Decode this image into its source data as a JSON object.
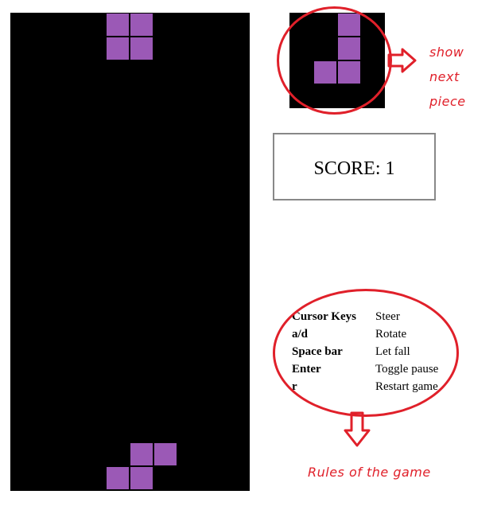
{
  "game": {
    "board": {
      "background_color": "#000000",
      "rows": 20,
      "cols": 10,
      "piece_color": "#9b59b6",
      "falling_piece": {
        "shape": "O",
        "cells": [
          [
            0,
            4
          ],
          [
            0,
            5
          ],
          [
            1,
            4
          ],
          [
            1,
            5
          ]
        ]
      },
      "stacked_blocks": {
        "shape": "S",
        "cells": [
          [
            18,
            5
          ],
          [
            18,
            6
          ],
          [
            19,
            4
          ],
          [
            19,
            5
          ]
        ]
      }
    },
    "next_piece": {
      "shape": "J",
      "color": "#9b59b6",
      "rows": 4,
      "cols": 4,
      "cells": [
        [
          0,
          2
        ],
        [
          1,
          2
        ],
        [
          2,
          1
        ],
        [
          2,
          2
        ]
      ]
    },
    "score": {
      "text": "SCORE: 1",
      "label": "SCORE:",
      "value": 1
    },
    "controls": [
      {
        "key": "Cursor Keys",
        "action": "Steer"
      },
      {
        "key": "a/d",
        "action": "Rotate"
      },
      {
        "key": "Space bar",
        "action": "Let fall"
      },
      {
        "key": "Enter",
        "action": "Toggle pause"
      },
      {
        "key": "r",
        "action": "Restart game"
      }
    ]
  },
  "annotations": {
    "color": "#e0202a",
    "next_piece_note": "show next piece",
    "rules_note": "Rules of the game"
  }
}
